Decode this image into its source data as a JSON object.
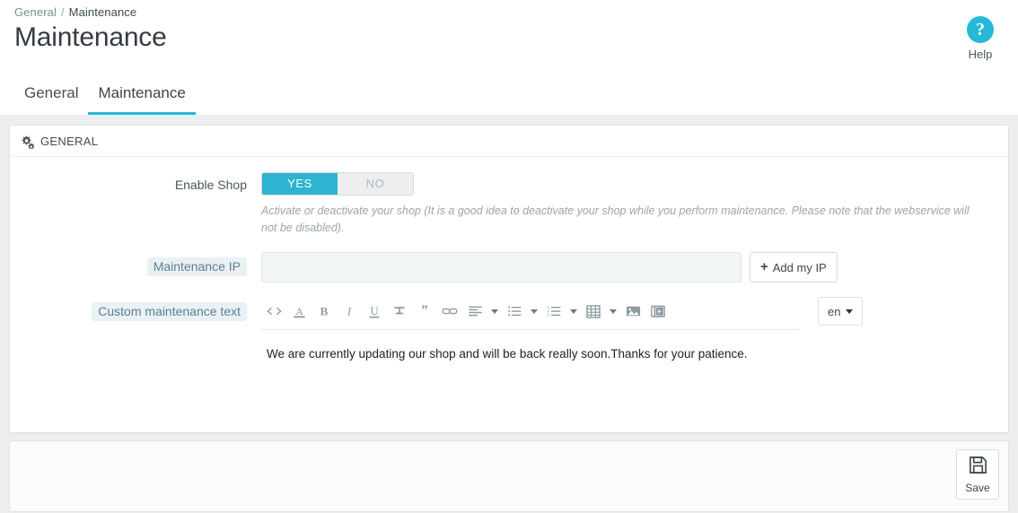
{
  "breadcrumb": {
    "parent": "General",
    "separator": "/",
    "current": "Maintenance"
  },
  "page_title": "Maintenance",
  "help": {
    "icon": "question-circle-icon",
    "label": "Help"
  },
  "tabs": [
    {
      "label": "General",
      "active": false
    },
    {
      "label": "Maintenance",
      "active": true
    }
  ],
  "panel": {
    "icon": "cogs-icon",
    "heading": "GENERAL",
    "fields": {
      "enable_shop": {
        "label": "Enable Shop",
        "yes_label": "YES",
        "no_label": "NO",
        "value": "yes",
        "hint": "Activate or deactivate your shop (It is a good idea to deactivate your shop while you perform maintenance. Please note that the webservice will not be disabled)."
      },
      "maintenance_ip": {
        "label": "Maintenance IP",
        "value": "",
        "placeholder": "",
        "add_button": "Add my IP"
      },
      "custom_text": {
        "label": "Custom maintenance text",
        "content": "We are currently updating our shop and will be back really soon.Thanks for your patience.",
        "language": "en",
        "toolbar": [
          {
            "name": "source-code-icon",
            "has_caret": false
          },
          {
            "name": "text-color-icon",
            "has_caret": false
          },
          {
            "name": "bold-icon",
            "has_caret": false
          },
          {
            "name": "italic-icon",
            "has_caret": false
          },
          {
            "name": "underline-icon",
            "has_caret": false
          },
          {
            "name": "strikethrough-icon",
            "has_caret": false
          },
          {
            "name": "blockquote-icon",
            "has_caret": false
          },
          {
            "name": "link-icon",
            "has_caret": false
          },
          {
            "name": "align-left-icon",
            "has_caret": true
          },
          {
            "name": "unordered-list-icon",
            "has_caret": true
          },
          {
            "name": "ordered-list-icon",
            "has_caret": true
          },
          {
            "name": "table-icon",
            "has_caret": true
          },
          {
            "name": "image-icon",
            "has_caret": false
          },
          {
            "name": "video-icon",
            "has_caret": false
          }
        ]
      }
    }
  },
  "footer": {
    "save_label": "Save",
    "save_icon": "floppy-disk-icon"
  },
  "colors": {
    "accent": "#25b9d7",
    "switch_on": "#2eb3d0",
    "content_bg": "#eceeef",
    "panel_border": "#dfe2e5",
    "label_chip_bg": "#eaf1f4",
    "label_chip_text": "#5e7f8f"
  }
}
